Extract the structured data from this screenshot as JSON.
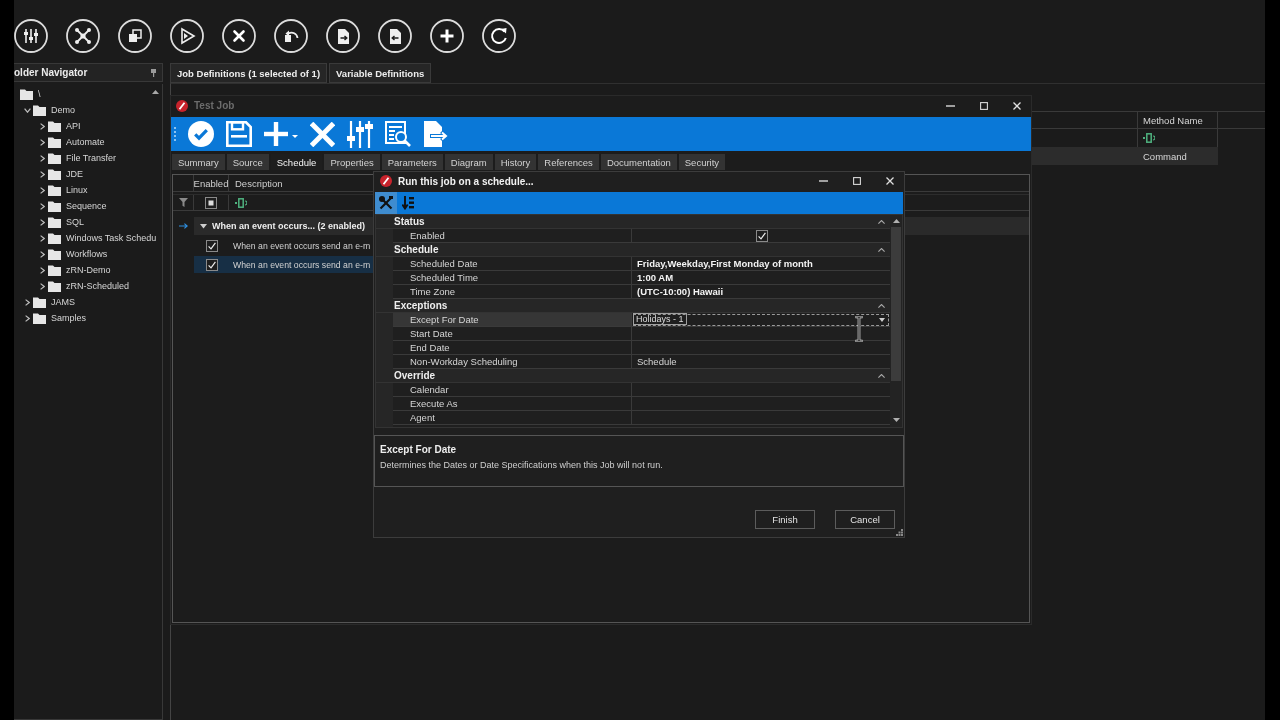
{
  "app": {
    "navigator": {
      "title": "older Navigator",
      "tree": [
        {
          "label": "\\",
          "children": [
            {
              "label": "Demo",
              "expanded": true,
              "children": [
                {
                  "label": "API",
                  "expanded": false
                },
                {
                  "label": "Automate",
                  "expanded": false
                },
                {
                  "label": "File Transfer",
                  "expanded": false
                },
                {
                  "label": "JDE",
                  "expanded": false
                },
                {
                  "label": "Linux",
                  "expanded": false
                },
                {
                  "label": "Sequence",
                  "expanded": false
                },
                {
                  "label": "SQL",
                  "expanded": false
                },
                {
                  "label": "Windows Task Schedu",
                  "expanded": false
                },
                {
                  "label": "Workflows",
                  "expanded": false
                },
                {
                  "label": "zRN-Demo",
                  "expanded": false
                },
                {
                  "label": "zRN-Scheduled",
                  "expanded": false
                }
              ]
            },
            {
              "label": "JAMS",
              "expanded": false
            },
            {
              "label": "Samples",
              "expanded": false
            }
          ]
        }
      ]
    },
    "tabs": [
      {
        "label": "Job Definitions (1 selected of 1)"
      },
      {
        "label": "Variable Definitions"
      }
    ],
    "job_grid": {
      "columns": [
        "Method Name"
      ],
      "rows": [
        {
          "method_name": "Command",
          "selected": true
        }
      ]
    }
  },
  "job_window": {
    "title": "Test Job",
    "active": false,
    "tabs": [
      {
        "label": "Summary",
        "selected": false
      },
      {
        "label": "Source",
        "selected": false
      },
      {
        "label": "Schedule",
        "selected": true
      },
      {
        "label": "Properties",
        "selected": false
      },
      {
        "label": "Parameters",
        "selected": false
      },
      {
        "label": "Diagram",
        "selected": false
      },
      {
        "label": "History",
        "selected": false
      },
      {
        "label": "References",
        "selected": false
      },
      {
        "label": "Documentation",
        "selected": false
      },
      {
        "label": "Security",
        "selected": false
      }
    ],
    "grid": {
      "columns": [
        "Enabled",
        "Description"
      ],
      "filter_row": {
        "indeterminate": true
      },
      "group": {
        "label": "When an event occurs... (2 enabled)",
        "expanded": true,
        "current": true
      },
      "rows": [
        {
          "enabled": true,
          "description": "When an event occurs send an e-m",
          "selected": false
        },
        {
          "enabled": true,
          "description": "When an event occurs send an e-m",
          "selected": true
        }
      ]
    }
  },
  "schedule_dialog": {
    "title": "Run this job on a schedule...",
    "active": true,
    "toolbar_buttons": [
      {
        "kind": "tools",
        "selected": true
      },
      {
        "kind": "sort",
        "selected": false
      }
    ],
    "categories": [
      {
        "label": "Status",
        "expanded": true,
        "properties": [
          {
            "label": "Enabled",
            "kind": "checkbox",
            "checked": true,
            "selected": false
          }
        ]
      },
      {
        "label": "Schedule",
        "expanded": true,
        "properties": [
          {
            "label": "Scheduled Date",
            "kind": "text",
            "value": "Friday,Weekday,First Monday of month",
            "modified": true,
            "selected": false
          },
          {
            "label": "Scheduled Time",
            "kind": "text",
            "value": "1:00 AM",
            "modified": true,
            "selected": false
          },
          {
            "label": "Time Zone",
            "kind": "text",
            "value": "(UTC-10:00) Hawaii",
            "modified": true,
            "selected": false
          }
        ]
      },
      {
        "label": "Exceptions",
        "expanded": true,
        "properties": [
          {
            "label": "Except For Date",
            "kind": "dropdown",
            "value": "Holidays - 1",
            "modified": false,
            "selected": true
          },
          {
            "label": "Start Date",
            "kind": "text",
            "selected": false
          },
          {
            "label": "End Date",
            "kind": "text",
            "selected": false
          },
          {
            "label": "Non-Workday Scheduling",
            "kind": "text",
            "value": "Schedule",
            "modified": false,
            "selected": false
          }
        ]
      },
      {
        "label": "Override",
        "expanded": true,
        "properties": [
          {
            "label": "Calendar",
            "kind": "text",
            "selected": false
          },
          {
            "label": "Execute As",
            "kind": "text",
            "selected": false
          },
          {
            "label": "Agent",
            "kind": "text",
            "selected": false
          }
        ]
      }
    ],
    "help": {
      "title": "Except For Date",
      "text": "Determines the Dates or Date Specifications when this Job will not run."
    },
    "buttons": [
      "Finish",
      "Cancel"
    ]
  }
}
